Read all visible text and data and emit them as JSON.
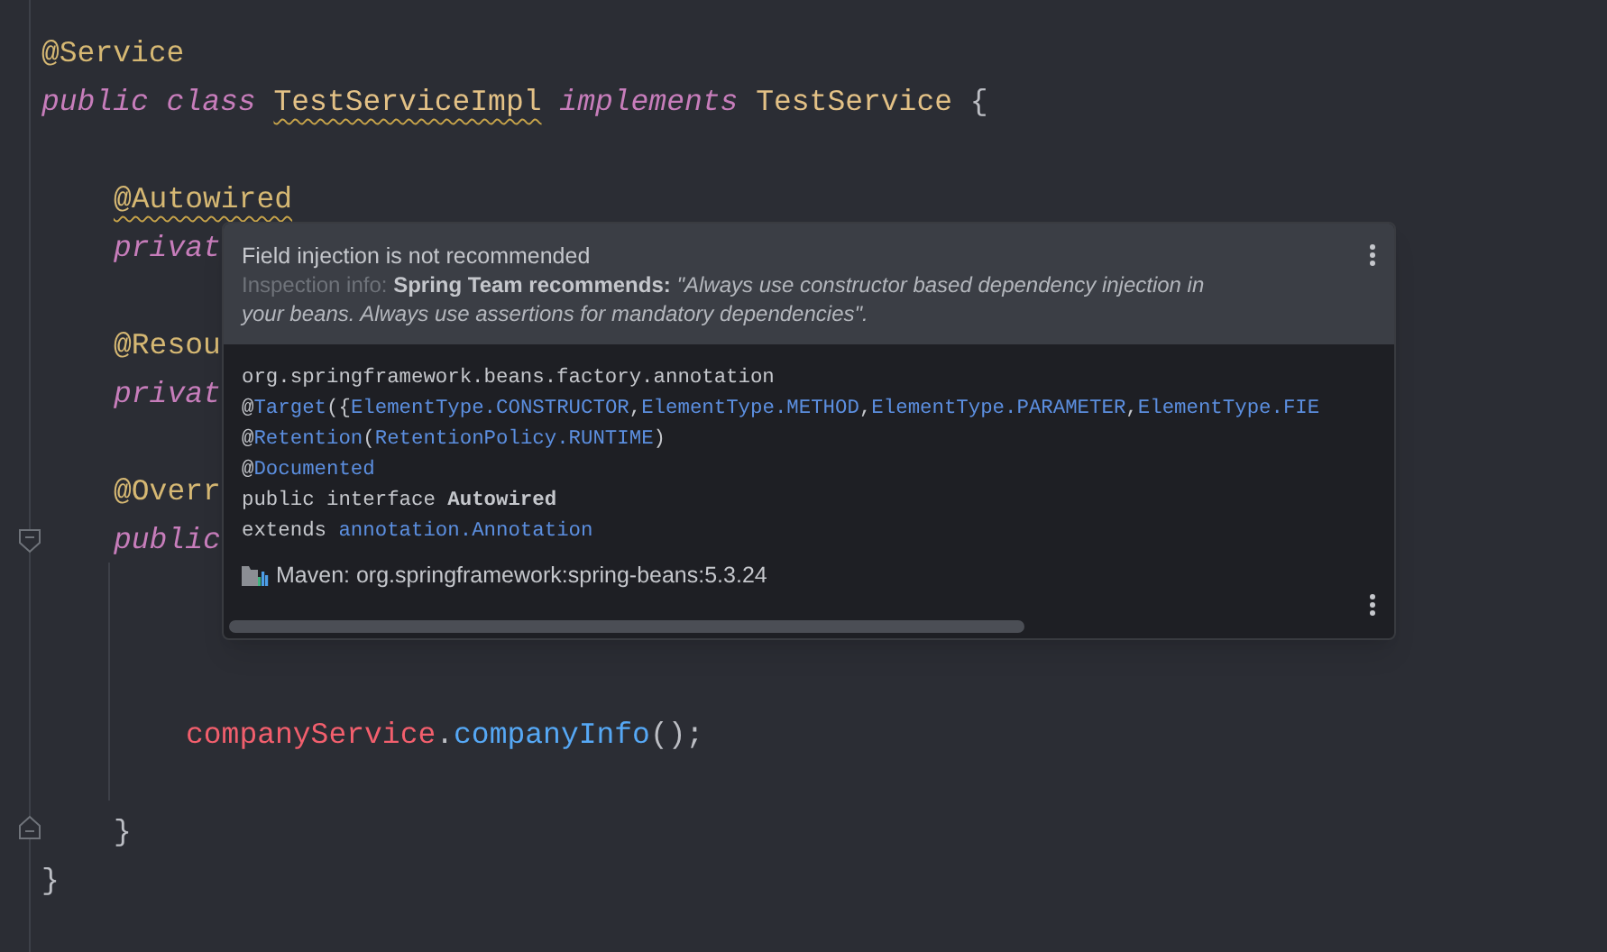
{
  "editor": {
    "lines": [
      {
        "segments": [
          {
            "text": "@Service",
            "kind": "annotation"
          }
        ]
      },
      {
        "segments": [
          {
            "text": "public class ",
            "kind": "keyword"
          },
          {
            "text": "TestServiceImpl",
            "kind": "class",
            "warning": true
          },
          {
            "text": " implements ",
            "kind": "keyword"
          },
          {
            "text": "TestService",
            "kind": "class"
          },
          {
            "text": " {",
            "kind": "plain"
          }
        ],
        "children": [
          {
            "gap_before": true,
            "segments": [
              {
                "text": "@Autowired",
                "kind": "annotation",
                "warning": true
              }
            ]
          },
          {
            "segments": [
              {
                "text": "privat",
                "kind": "keyword"
              }
            ]
          },
          {
            "gap_before": true,
            "segments": [
              {
                "text": "@Resou",
                "kind": "annotation"
              }
            ]
          },
          {
            "segments": [
              {
                "text": "privat",
                "kind": "keyword"
              }
            ]
          },
          {
            "gap_before": true,
            "segments": [
              {
                "text": "@Overr",
                "kind": "annotation"
              }
            ]
          },
          {
            "segments": [
              {
                "text": "public",
                "kind": "keyword"
              }
            ],
            "children": [
              {
                "gap_before": true,
                "segments": [
                  {
                    "text": "companyService",
                    "kind": "field"
                  },
                  {
                    "text": ".",
                    "kind": "plain"
                  },
                  {
                    "text": "companyInfo",
                    "kind": "method"
                  },
                  {
                    "text": "();",
                    "kind": "plain"
                  }
                ]
              }
            ]
          },
          {
            "gap_before": true,
            "segments": [
              {
                "text": "}",
                "kind": "plain"
              }
            ]
          }
        ]
      },
      {
        "segments": [
          {
            "text": "}",
            "kind": "plain"
          }
        ]
      }
    ]
  },
  "popup": {
    "title": "Field injection is not recommended",
    "description": [
      {
        "text": "Inspection info: ",
        "kind": "label"
      },
      {
        "text": "Spring Team recommends: ",
        "kind": "bold"
      },
      {
        "text": "\"Always use constructor based dependency injection in your beans. Always use assertions for mandatory dependencies\".",
        "kind": "italic"
      }
    ],
    "doc_lines": [
      [
        {
          "text": "org.springframework.beans.factory.annotation",
          "kind": "plain"
        }
      ],
      [
        {
          "text": "@",
          "kind": "plain"
        },
        {
          "text": "Target",
          "kind": "link"
        },
        {
          "text": "({",
          "kind": "plain"
        },
        {
          "text": "ElementType.CONSTRUCTOR",
          "kind": "link"
        },
        {
          "text": ",",
          "kind": "plain"
        },
        {
          "text": "ElementType.METHOD",
          "kind": "link"
        },
        {
          "text": ",",
          "kind": "plain"
        },
        {
          "text": "ElementType.PARAMETER",
          "kind": "link"
        },
        {
          "text": ",",
          "kind": "plain"
        },
        {
          "text": "ElementType.FIE",
          "kind": "link"
        }
      ],
      [
        {
          "text": "@",
          "kind": "plain"
        },
        {
          "text": "Retention",
          "kind": "link"
        },
        {
          "text": "(",
          "kind": "plain"
        },
        {
          "text": "RetentionPolicy.RUNTIME",
          "kind": "link"
        },
        {
          "text": ")",
          "kind": "plain"
        }
      ],
      [
        {
          "text": "@",
          "kind": "plain"
        },
        {
          "text": "Documented",
          "kind": "link"
        }
      ],
      [
        {
          "text": "public interface ",
          "kind": "plain"
        },
        {
          "text": "Autowired",
          "kind": "bold"
        }
      ],
      [
        {
          "text": "extends ",
          "kind": "plain"
        },
        {
          "text": "annotation.Annotation",
          "kind": "link"
        }
      ]
    ],
    "library": "Maven: org.springframework:spring-beans:5.3.24"
  }
}
